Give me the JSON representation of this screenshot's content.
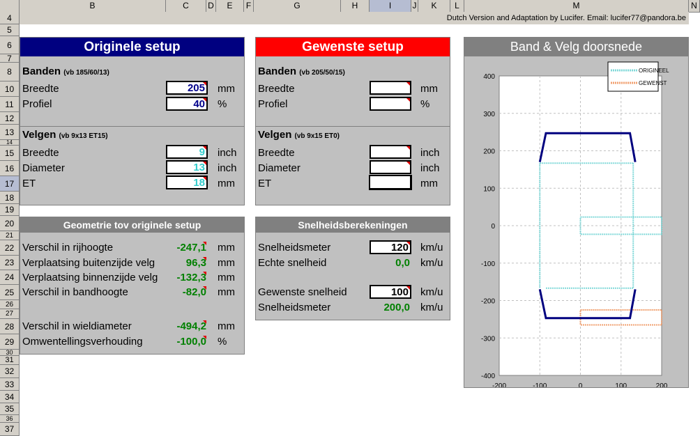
{
  "columns": [
    "B",
    "C",
    "D",
    "E",
    "F",
    "G",
    "H",
    "I",
    "J",
    "K",
    "L",
    "M",
    "N"
  ],
  "rows": [
    "4",
    "5",
    "6",
    "7",
    "8",
    "10",
    "11",
    "12",
    "13",
    "14",
    "15",
    "16",
    "17",
    "18",
    "19",
    "20",
    "21",
    "22",
    "23",
    "24",
    "25",
    "26",
    "27",
    "28",
    "29",
    "30",
    "31",
    "32",
    "33",
    "34",
    "35",
    "36",
    "37"
  ],
  "credit": "Dutch Version and Adaptation by Lucifer. Email: lucifer77@pandora.be",
  "original": {
    "title": "Originele setup",
    "tires_title": "Banden",
    "tires_example": "(vb 185/60/13)",
    "width_label": "Breedte",
    "width_value": "205",
    "width_unit": "mm",
    "profile_label": "Profiel",
    "profile_value": "40",
    "profile_unit": "%",
    "rims_title": "Velgen",
    "rims_example": "(vb 9x13 ET15)",
    "rim_width_label": "Breedte",
    "rim_width_value": "9",
    "rim_width_unit": "inch",
    "diameter_label": "Diameter",
    "diameter_value": "13",
    "diameter_unit": "inch",
    "et_label": "ET",
    "et_value": "18",
    "et_unit": "mm"
  },
  "desired": {
    "title": "Gewenste setup",
    "tires_title": "Banden",
    "tires_example": "(vb 205/50/15)",
    "width_label": "Breedte",
    "width_value": "",
    "width_unit": "mm",
    "profile_label": "Profiel",
    "profile_value": "",
    "profile_unit": "%",
    "rims_title": "Velgen",
    "rims_example": "(vb 9x15 ET0)",
    "rim_width_label": "Breedte",
    "rim_width_value": "",
    "rim_width_unit": "inch",
    "diameter_label": "Diameter",
    "diameter_value": "",
    "diameter_unit": "inch",
    "et_label": "ET",
    "et_value": "",
    "et_unit": "mm"
  },
  "geometry": {
    "title": "Geometrie tov originele setup",
    "rows": [
      {
        "label": "Verschil in rijhoogte",
        "value": "-247,1",
        "unit": "mm"
      },
      {
        "label": "Verplaatsing buitenzijde velg",
        "value": "96,3",
        "unit": "mm"
      },
      {
        "label": "Verplaatsing binnenzijde velg",
        "value": "-132,3",
        "unit": "mm"
      },
      {
        "label": "Verschil in bandhoogte",
        "value": "-82,0",
        "unit": "mm"
      },
      {
        "label": "Verschil in wieldiameter",
        "value": "-494,2",
        "unit": "mm"
      },
      {
        "label": "Omwentellingsverhouding",
        "value": "-100,0",
        "unit": "%"
      }
    ]
  },
  "speed": {
    "title": "Snelheidsberekeningen",
    "speedometer_label": "Snelheidsmeter",
    "speedometer_value": "120",
    "speedometer_unit": "km/u",
    "real_label": "Echte snelheid",
    "real_value": "0,0",
    "real_unit": "km/u",
    "desired_label": "Gewenste snelheid",
    "desired_value": "100",
    "desired_unit": "km/u",
    "meter2_label": "Snelheidsmeter",
    "meter2_value": "200,0",
    "meter2_unit": "km/u"
  },
  "chart_title": "Band & Velg doorsnede",
  "chart_data": {
    "type": "line",
    "title": "Band & Velg doorsnede",
    "xlim": [
      -200,
      200
    ],
    "ylim": [
      -400,
      400
    ],
    "xticks": [
      -200,
      -100,
      0,
      100,
      200
    ],
    "yticks": [
      -400,
      -300,
      -200,
      -100,
      0,
      100,
      200,
      300,
      400
    ],
    "grid": true,
    "legend_position": "top-right",
    "series": [
      {
        "name": "ORIGINEEL",
        "color": "#7fd8d8",
        "segments": [
          [
            [
              -100,
              167
            ],
            [
              130,
              167
            ]
          ],
          [
            [
              -100,
              167
            ],
            [
              -100,
              -167
            ]
          ],
          [
            [
              130,
              167
            ],
            [
              130,
              -167
            ]
          ],
          [
            [
              -85,
              -167
            ],
            [
              130,
              -167
            ]
          ],
          [
            [
              0,
              23
            ],
            [
              200,
              23
            ],
            [
              200,
              -23
            ],
            [
              0,
              -23
            ],
            [
              0,
              23
            ]
          ]
        ]
      },
      {
        "name": "GEWENST",
        "color": "#f0a070",
        "segments": [
          [
            [
              0,
              -225
            ],
            [
              200,
              -225
            ],
            [
              200,
              -265
            ],
            [
              0,
              -265
            ],
            [
              0,
              -225
            ]
          ]
        ]
      },
      {
        "name": "",
        "color": "#00007f",
        "segments": [
          [
            [
              -100,
              170
            ],
            [
              -85,
              247
            ],
            [
              122,
              247
            ],
            [
              135,
              170
            ]
          ],
          [
            [
              -100,
              -170
            ],
            [
              -85,
              -247
            ],
            [
              122,
              -247
            ],
            [
              135,
              -170
            ]
          ]
        ]
      }
    ]
  }
}
